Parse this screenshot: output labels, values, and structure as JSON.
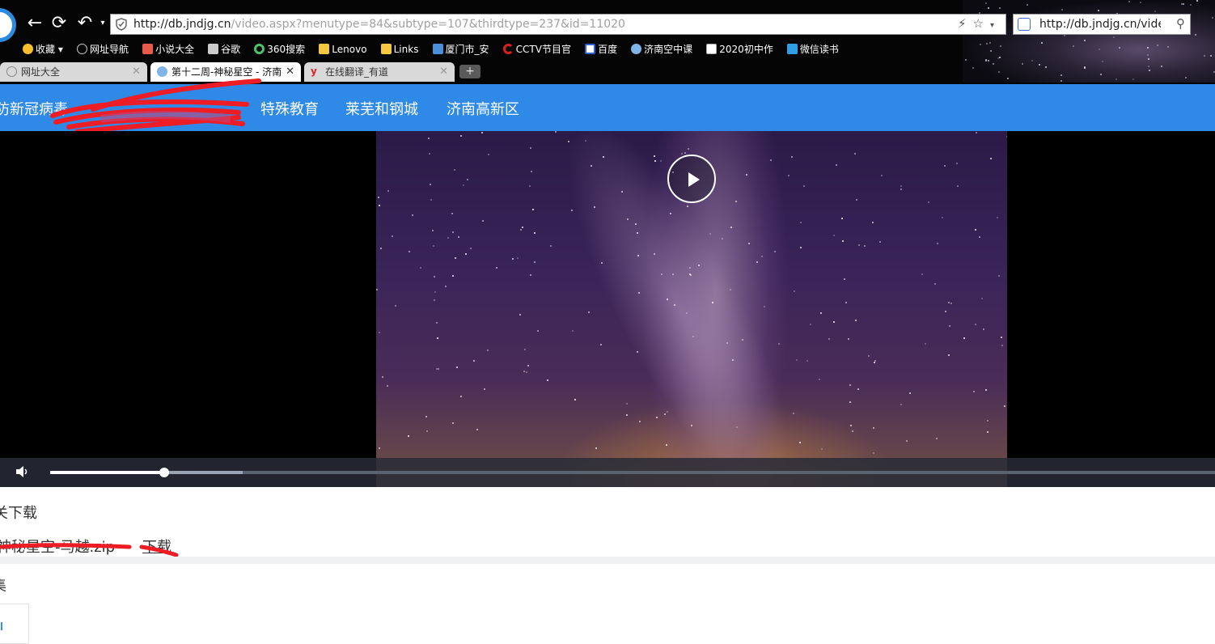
{
  "browser": {
    "address_url_main": "http://db.jndjg.cn",
    "address_url_rest": "/video.aspx?menutype=84&subtype=107&thirdtype=237&id=11020",
    "search_value": "http://db.jndjg.cn/video",
    "bookmarks": [
      "收藏",
      "网址导航",
      "小说大全",
      "谷歌",
      "360搜索",
      "Lenovo",
      "Links",
      "厦门市_安",
      "CCTV节目官",
      "百度",
      "济南空中课",
      "2020初中作",
      "微信读书"
    ],
    "tabs": [
      {
        "label": "网址大全",
        "state": "inactive"
      },
      {
        "label": "第十二周-神秘星空 - 济南",
        "state": "active"
      },
      {
        "label": "在线翻译_有道",
        "state": "inactive"
      }
    ],
    "new_tab_label": "+"
  },
  "site": {
    "nav": [
      "防新冠病毒",
      "特殊教育",
      "莱芜和钢城",
      "济南高新区"
    ],
    "accent": "#2e8ae6"
  },
  "player": {
    "progress_played": 0.098,
    "progress_buffered": 0.165
  },
  "downloads": {
    "title": "关下载",
    "file_name": "神秘星空-马越.zip",
    "link": "下载"
  },
  "section2": {
    "title": "集"
  }
}
